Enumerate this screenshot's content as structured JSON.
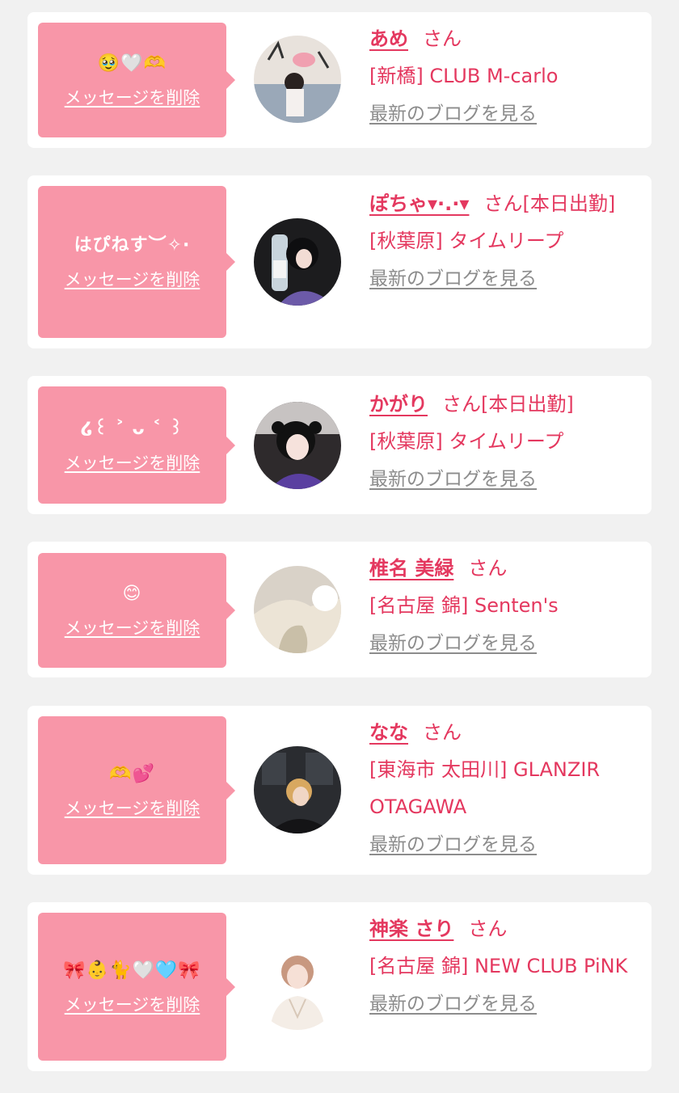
{
  "labels": {
    "delete": "メッセージを削除",
    "blog": "最新のブログを見る"
  },
  "entries": [
    {
      "message": "🥹🤍🫶",
      "name": "あめ",
      "honorific": "さん",
      "status": "",
      "shop": "[新橋] CLUB M-carlo",
      "avatar_icon": "girl-photo-icon"
    },
    {
      "message": "はぴねす︶✧·",
      "name": "ぽちゃ▾·.·▾",
      "honorific": "さん",
      "status": "[本日出勤]",
      "shop": "[秋葉原] タイムリープ",
      "avatar_icon": "girl-photo-icon"
    },
    {
      "message": "໒꒰ ˃ ᴗ ˂ ꒱",
      "name": "かがり",
      "honorific": "さん",
      "status": "[本日出勤]",
      "shop": "[秋葉原] タイムリープ",
      "avatar_icon": "girl-photo-icon"
    },
    {
      "message": "😊",
      "name": "椎名 美緑",
      "honorific": "さん",
      "status": "",
      "shop": "[名古屋 錦] Senten's",
      "avatar_icon": "girl-photo-icon"
    },
    {
      "message": "🫶💕",
      "name": "なな",
      "honorific": "さん",
      "status": "",
      "shop": "[東海市 太田川] GLANZIR OTAGAWA",
      "avatar_icon": "girl-photo-icon"
    },
    {
      "message": "🎀👶🐈🤍🩵🎀",
      "name": "神楽 さり",
      "honorific": "さん",
      "status": "",
      "shop": "[名古屋 錦] NEW CLUB PiNK",
      "avatar_icon": "girl-photo-icon"
    }
  ],
  "colors": {
    "accent": "#e4385f",
    "bubble": "#f896a8",
    "background": "#f1f1f1",
    "link_gray": "#8c8c8c"
  }
}
